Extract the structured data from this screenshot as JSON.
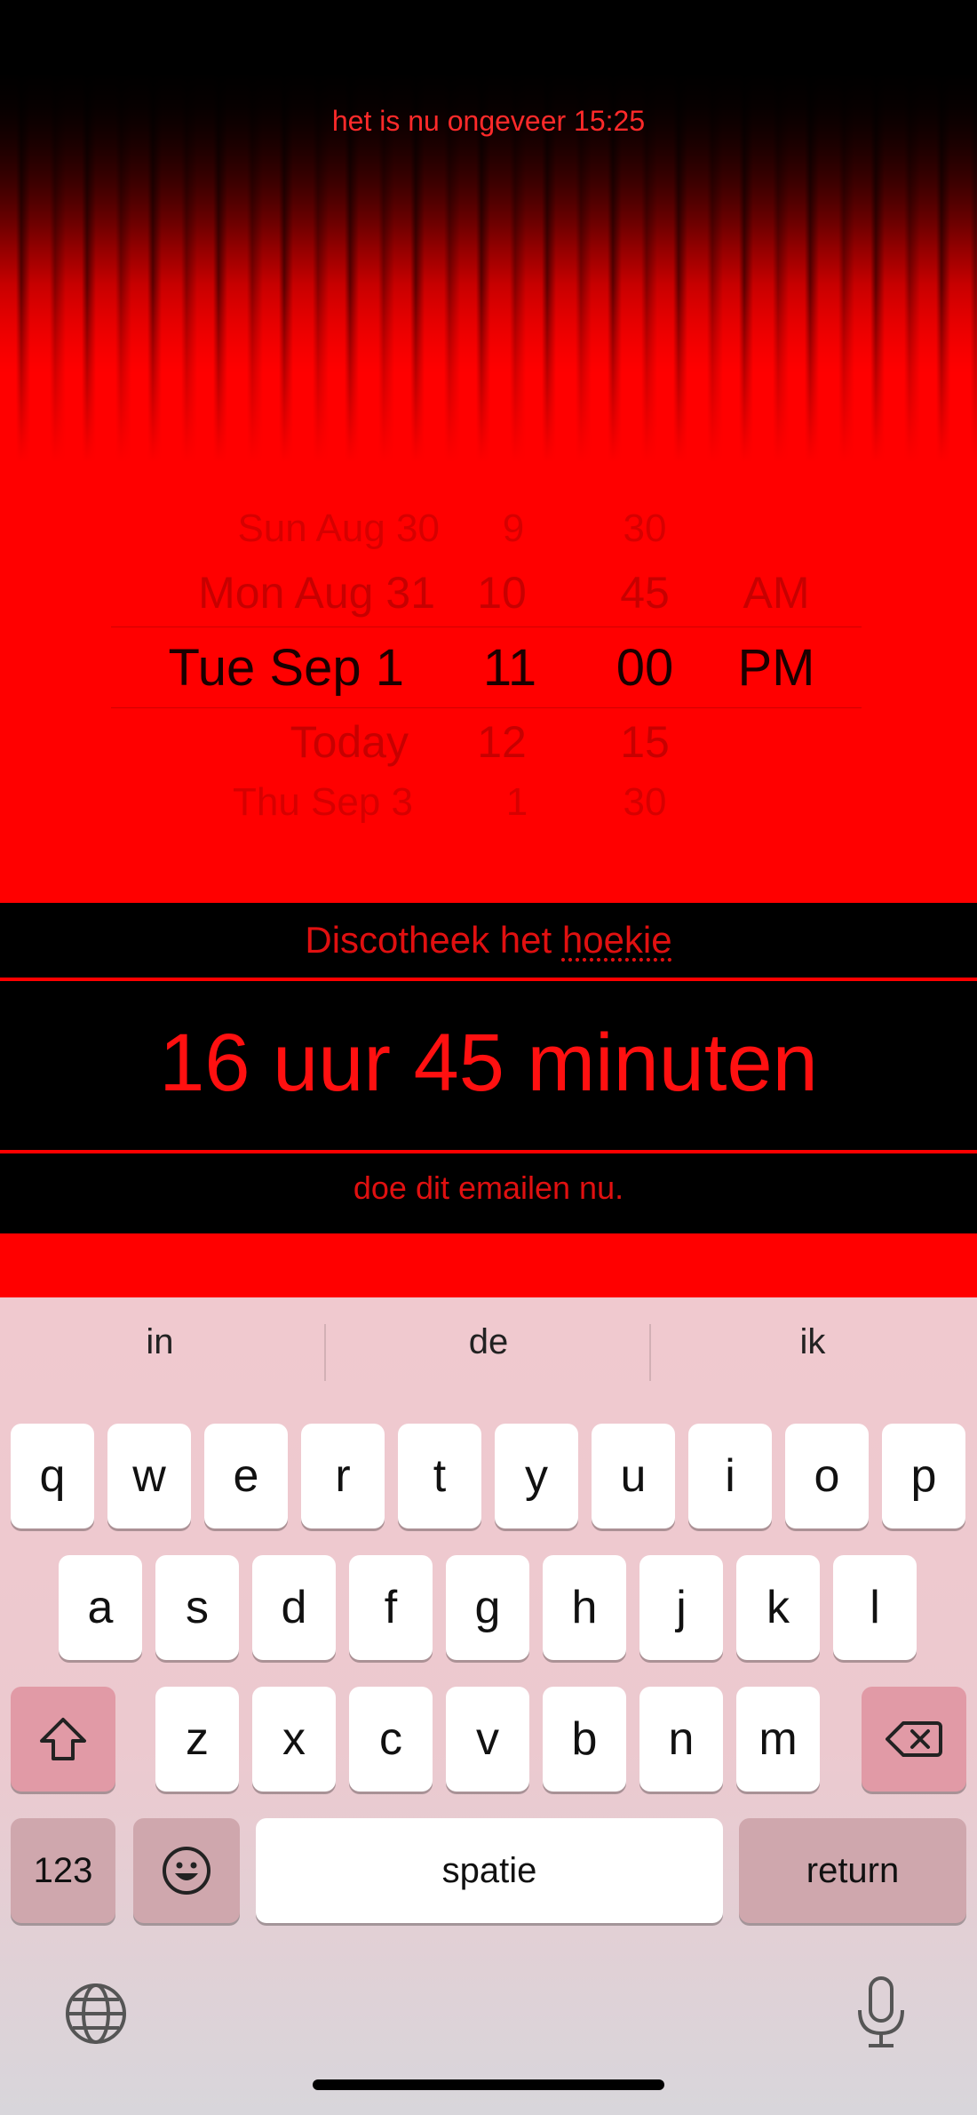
{
  "status": {
    "time_text": "het is nu ongeveer 15:25"
  },
  "picker": {
    "rows": [
      {
        "date": "Sun Aug 30",
        "hour": "9",
        "minute": "30",
        "ampm": ""
      },
      {
        "date": "Mon Aug 31",
        "hour": "10",
        "minute": "45",
        "ampm": "AM"
      },
      {
        "date": "Tue Sep 1",
        "hour": "11",
        "minute": "00",
        "ampm": "PM"
      },
      {
        "date": "Today",
        "hour": "12",
        "minute": "15",
        "ampm": ""
      },
      {
        "date": "Thu Sep 3",
        "hour": "1",
        "minute": "30",
        "ampm": ""
      }
    ]
  },
  "event": {
    "name_prefix": "Discotheek het ",
    "name_misspelled": "hoekie"
  },
  "countdown": {
    "text": "16 uur 45 minuten"
  },
  "action": {
    "email_text": "doe dit emailen nu."
  },
  "keyboard": {
    "suggestions": [
      "in",
      "de",
      "ik"
    ],
    "row1": [
      "q",
      "w",
      "e",
      "r",
      "t",
      "y",
      "u",
      "i",
      "o",
      "p"
    ],
    "row2": [
      "a",
      "s",
      "d",
      "f",
      "g",
      "h",
      "j",
      "k",
      "l"
    ],
    "row3": [
      "z",
      "x",
      "c",
      "v",
      "b",
      "n",
      "m"
    ],
    "numbers_label": "123",
    "space_label": "spatie",
    "return_label": "return",
    "icons": {
      "shift": "shift-icon",
      "backspace": "backspace-icon",
      "emoji": "emoji-icon",
      "globe": "globe-icon",
      "mic": "microphone-icon"
    }
  },
  "colors": {
    "accent": "#ff0000",
    "text_red": "#e01010",
    "panel": "#000000"
  }
}
